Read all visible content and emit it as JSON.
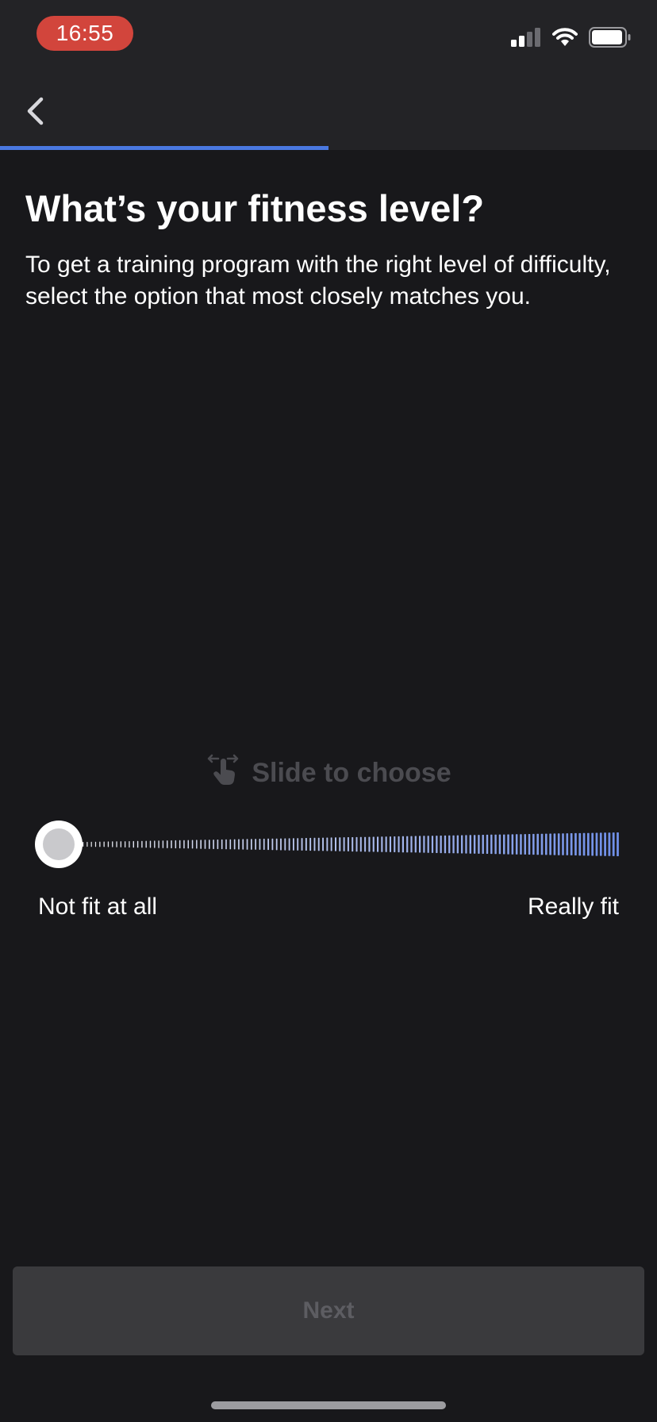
{
  "status_bar": {
    "time": "16:55",
    "icons": [
      "cellular-signal-icon",
      "wifi-icon",
      "battery-icon"
    ]
  },
  "nav": {
    "back_icon": "chevron-left-icon"
  },
  "progress": {
    "fraction": 0.5,
    "color": "#4a78e0"
  },
  "content": {
    "title": "What’s your fitness level?",
    "subtitle": "To get a training program with the right level of difficulty, select the option that most closely matches you."
  },
  "slider": {
    "hint": "Slide to choose",
    "hint_icon": "swipe-hand-icon",
    "min_label": "Not fit at all",
    "max_label": "Really fit",
    "value": 0,
    "accent_color": "#6f8fe8"
  },
  "footer": {
    "next_label": "Next"
  },
  "colors": {
    "background": "#18181b",
    "header": "#232326",
    "time_pill": "#d2453c",
    "button_disabled": "#3a3a3d"
  }
}
